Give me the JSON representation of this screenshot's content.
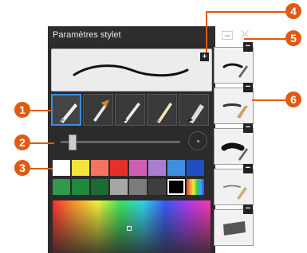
{
  "window": {
    "title": "Paramètres stylet",
    "add_label": "+",
    "close_label": "✕"
  },
  "colors": {
    "accent": "#e05a12",
    "selection": "#3a8ee6",
    "panel": "#2b2b2b"
  },
  "pen_types": [
    {
      "name": "fountain-pen",
      "selected": true
    },
    {
      "name": "brush",
      "selected": false
    },
    {
      "name": "pencil",
      "selected": false
    },
    {
      "name": "highlighter",
      "selected": false
    },
    {
      "name": "marker",
      "selected": false
    }
  ],
  "slider": {
    "value": 0.1
  },
  "palette": [
    [
      "#ffffff",
      "#f5e23a",
      "#f2735f",
      "#e5302a",
      "#d05fb2",
      "#a87fd0",
      "#3e8fe0",
      "#1f4fc0"
    ],
    [
      "#2f9a4e",
      "#1f8a3c",
      "#1c6b32",
      "#a7a7a7",
      "#7b7b7b",
      "#3f3f3f",
      "#000000",
      "rainbow"
    ]
  ],
  "selected_color": "#000000",
  "presets": [
    {
      "minus_label": "−"
    },
    {
      "minus_label": "−"
    },
    {
      "minus_label": "−"
    },
    {
      "minus_label": "−"
    },
    {
      "minus_label": "−"
    }
  ],
  "callouts": [
    "1",
    "2",
    "3",
    "4",
    "5",
    "6"
  ]
}
